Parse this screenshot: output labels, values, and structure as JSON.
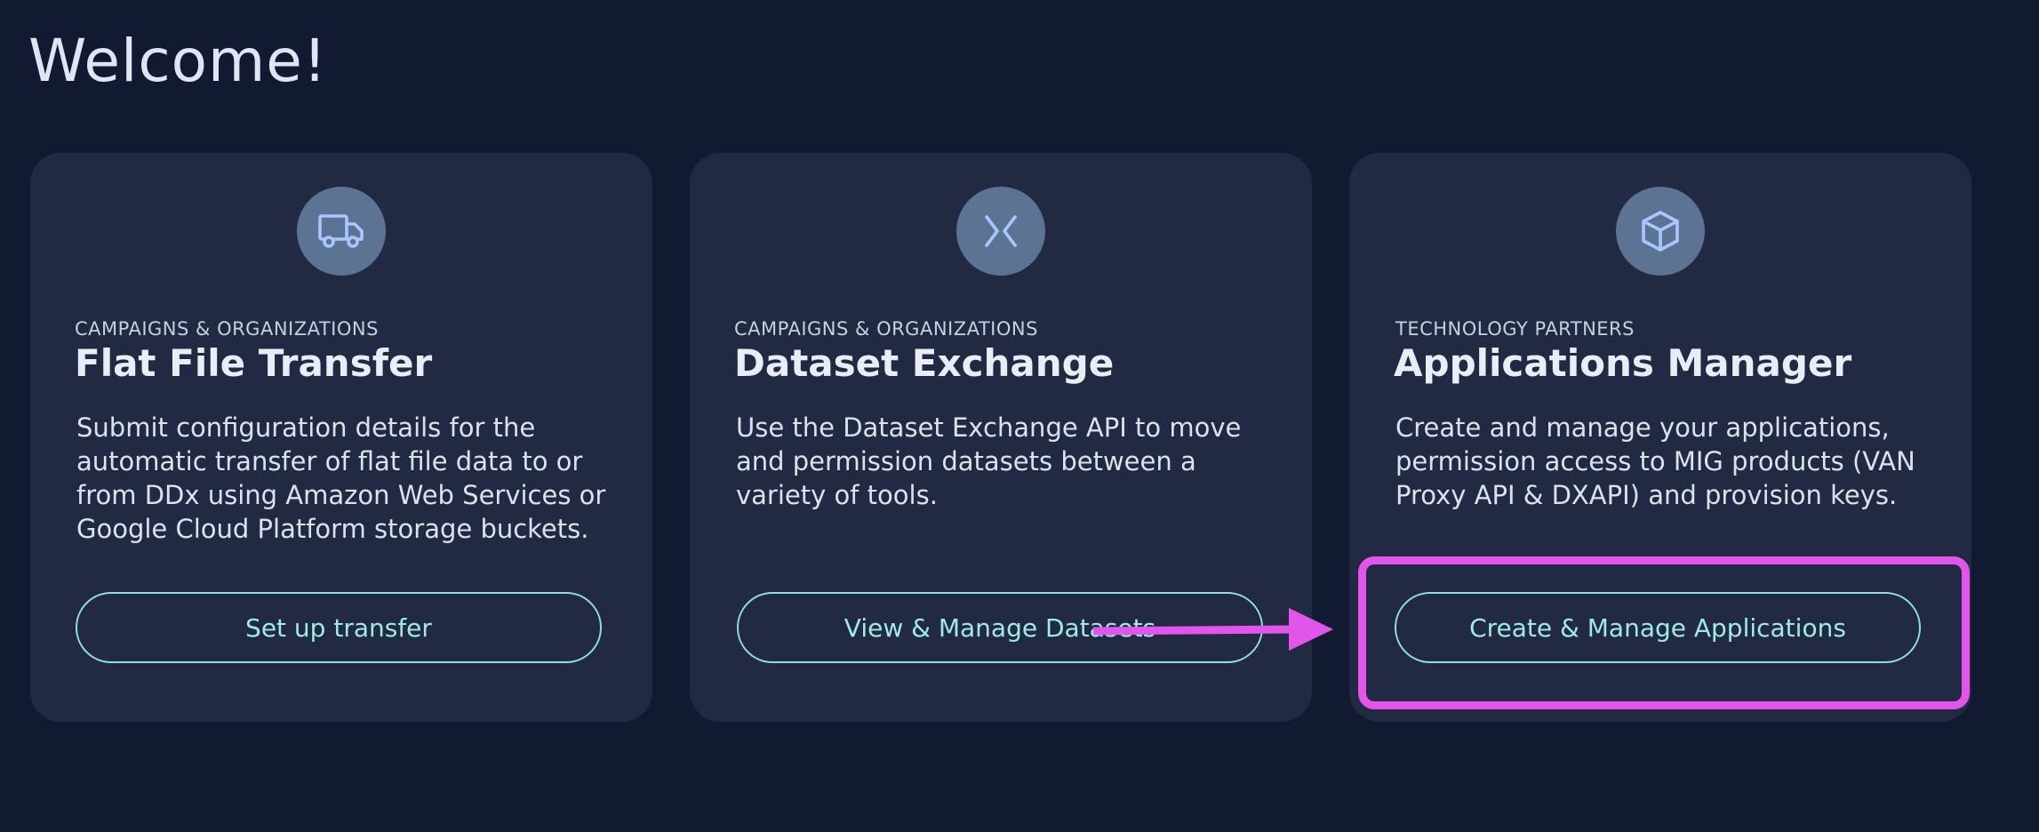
{
  "page": {
    "title": "Welcome!"
  },
  "cards": [
    {
      "icon": "truck-icon",
      "category": "CAMPAIGNS & ORGANIZATIONS",
      "title": "Flat File Transfer",
      "description": "Submit configuration details for the automatic transfer of flat file data to or from DDx using Amazon Web Services or Google Cloud Platform storage buckets.",
      "button_label": "Set up transfer"
    },
    {
      "icon": "exchange-arrows-icon",
      "category": "CAMPAIGNS & ORGANIZATIONS",
      "title": "Dataset Exchange",
      "description": "Use the Dataset Exchange API to move and permission datasets between a variety of tools.",
      "button_label": "View & Manage Datasets"
    },
    {
      "icon": "cube-icon",
      "category": "TECHNOLOGY PARTNERS",
      "title": "Applications Manager",
      "description": "Create and manage your applications, permission access to MIG products (VAN Proxy API & DXAPI) and provision keys.",
      "button_label": "Create & Manage Applications"
    }
  ],
  "colors": {
    "background": "#121a31",
    "card": "#212a42",
    "icon_circle": "#5d7393",
    "button_accent": "#8fe0dd",
    "annotation": "#e255ea"
  }
}
